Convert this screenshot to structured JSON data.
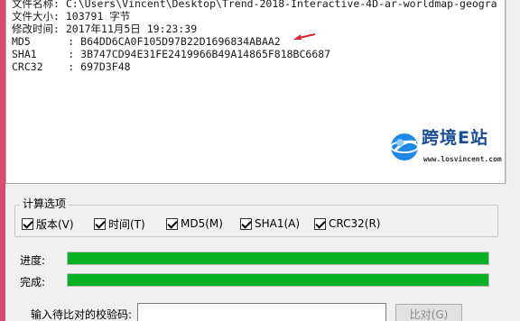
{
  "output": {
    "lines": [
      "文件名称: C:\\Users\\Vincent\\Desktop\\Trend-2018-Interactive-4D-ar-worldmap-geogra",
      "文件大小: 103791 字节",
      "修改时间: 2017年11月5日 19:23:39",
      "MD5      : B64DD6CA0F105D97B22D1696834ABAA2",
      "SHA1     : 3B747CD94E31FE2419966B49A14865F818BC6687",
      "CRC32    : 697D3F48"
    ]
  },
  "watermark": {
    "name": "跨境E站",
    "url": "www.losvincent.com"
  },
  "options": {
    "title": "计算选项",
    "items": [
      {
        "label": "版本(V)",
        "checked": true
      },
      {
        "label": "时间(T)",
        "checked": true
      },
      {
        "label": "MD5(M)",
        "checked": true
      },
      {
        "label": "SHA1(A)",
        "checked": true
      },
      {
        "label": "CRC32(R)",
        "checked": true
      }
    ]
  },
  "progress": {
    "label": "进度:",
    "value": 1.0
  },
  "complete": {
    "label": "完成:",
    "value": 1.0
  },
  "compare": {
    "label": "输入待比对的校验码:",
    "value": "",
    "button_label": "比对(G)"
  },
  "colors": {
    "progress_fill": "#06b025",
    "watermark_blue": "#1a4f96",
    "arrow_red": "#e0202a"
  }
}
